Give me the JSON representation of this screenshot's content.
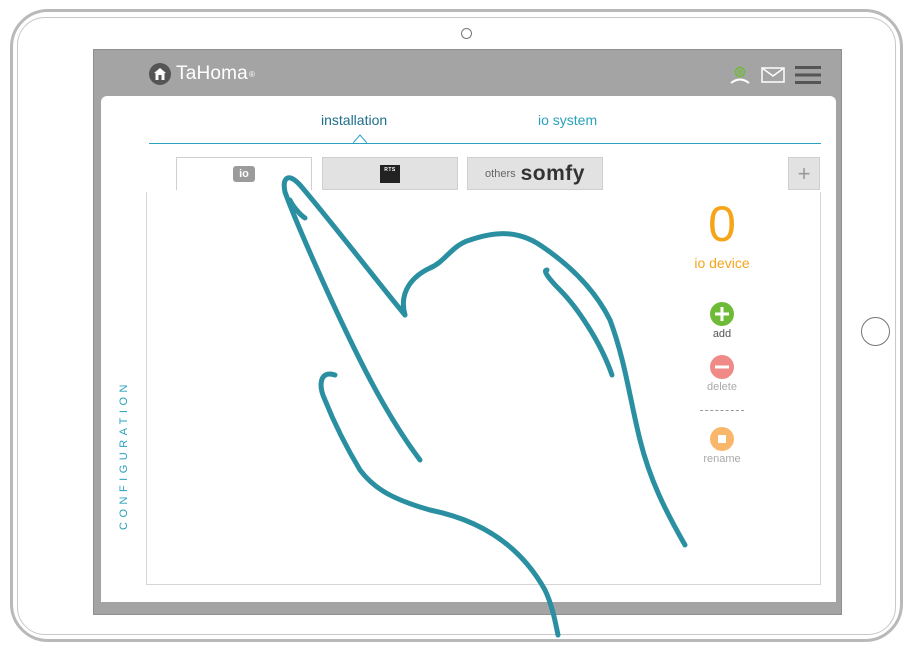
{
  "app": {
    "brand": "TaHoma",
    "registered_mark": "®"
  },
  "tabs": [
    {
      "label": "installation",
      "active": true
    },
    {
      "label": "io system",
      "active": false
    }
  ],
  "subtabs": [
    {
      "id": "io",
      "logo_text": "io",
      "active": true
    },
    {
      "id": "rts",
      "logo_text": "RTS",
      "active": false
    },
    {
      "id": "somfy",
      "prefix": "others",
      "brand": "somfy",
      "active": false
    }
  ],
  "sidebar": {
    "section_label": "CONFIGURATION"
  },
  "devices": {
    "count": "0",
    "label": "io device"
  },
  "actions": {
    "add": "add",
    "delete": "delete",
    "divider": "-------",
    "rename": "rename"
  },
  "toolbar": {
    "plus_label": "+"
  },
  "icons": [
    "house-icon",
    "user-at-icon",
    "mail-icon",
    "hamburger-menu-icon",
    "plus-icon",
    "minus-icon",
    "stop-icon",
    "hand-pointer-icon"
  ],
  "colors": {
    "accent": "#2aa1bd",
    "orange": "#f6a51a",
    "green": "#6dbb36",
    "red": "#ef8a86",
    "screen_bg": "#a4a4a4",
    "hand": "#2a8fa0"
  }
}
